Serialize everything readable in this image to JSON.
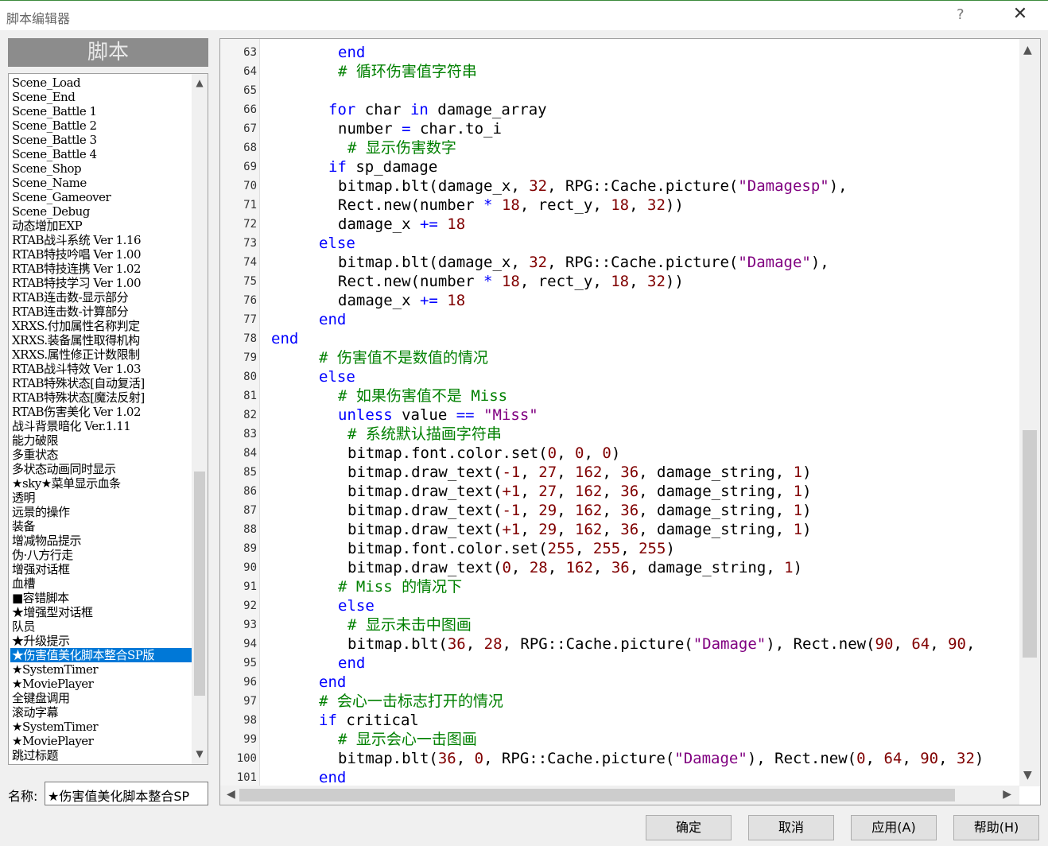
{
  "window": {
    "title": "脚本编辑器",
    "help": "?",
    "close": "✕"
  },
  "left": {
    "header": "脚本",
    "scripts": [
      "Scene_Load",
      "Scene_End",
      "Scene_Battle 1",
      "Scene_Battle 2",
      "Scene_Battle 3",
      "Scene_Battle 4",
      "Scene_Shop",
      "Scene_Name",
      "Scene_Gameover",
      "Scene_Debug",
      "动态增加EXP",
      "RTAB战斗系统 Ver 1.16",
      "RTAB特技吟唱 Ver 1.00",
      "RTAB特技连携 Ver 1.02",
      "RTAB特技学习 Ver 1.00",
      "RTAB连击数-显示部分",
      "RTAB连击数-计算部分",
      "XRXS.付加属性名称判定",
      "XRXS.装备属性取得机构",
      "XRXS.属性修正计数限制",
      "RTAB战斗特效 Ver 1.03",
      "RTAB特殊状态[自动复活]",
      "RTAB特殊状态[魔法反射]",
      "RTAB伤害美化 Ver 1.02",
      "战斗背景暗化 Ver.1.11",
      "能力破限",
      "多重状态",
      "多状态动画同时显示",
      "★sky★菜单显示血条",
      "透明",
      "远景的操作",
      "装备",
      "增减物品提示",
      "伪·八方行走",
      "增强对话框",
      "血槽",
      "■容错脚本",
      "★增强型对话框",
      "队员",
      "★升级提示",
      "★伤害值美化脚本整合SP版",
      "★SystemTimer",
      "★MoviePlayer",
      "全键盘调用",
      "滚动字幕",
      "★SystemTimer",
      "★MoviePlayer",
      "跳过标题"
    ],
    "selected_index": 40,
    "name_label": "名称:",
    "name_value": "★伤害值美化脚本整合SP"
  },
  "editor": {
    "lines": [
      {
        "n": "63",
        "indent": 4,
        "tokens": [
          [
            "kw",
            "end"
          ]
        ]
      },
      {
        "n": "64",
        "indent": 4,
        "tokens": [
          [
            "cm",
            "# 循环伤害值字符串"
          ]
        ]
      },
      {
        "n": "65",
        "indent": 0,
        "tokens": []
      },
      {
        "n": "66",
        "indent": 3,
        "tokens": [
          [
            "kw",
            "for"
          ],
          [
            "tx",
            " char "
          ],
          [
            "kw",
            "in"
          ],
          [
            "tx",
            " damage_array"
          ]
        ]
      },
      {
        "n": "67",
        "indent": 4,
        "tokens": [
          [
            "tx",
            "number "
          ],
          [
            "op",
            "="
          ],
          [
            "tx",
            " char.to_i"
          ]
        ]
      },
      {
        "n": "68",
        "indent": 5,
        "tokens": [
          [
            "cm",
            "# 显示伤害数字"
          ]
        ]
      },
      {
        "n": "69",
        "indent": 3,
        "tokens": [
          [
            "kw",
            "if"
          ],
          [
            "tx",
            " sp_damage"
          ]
        ]
      },
      {
        "n": "70",
        "indent": 4,
        "tokens": [
          [
            "tx",
            "bitmap.blt(damage_x, "
          ],
          [
            "nm",
            "32"
          ],
          [
            "tx",
            ", RPG::Cache.picture("
          ],
          [
            "st",
            "\"Damagesp\""
          ],
          [
            "tx",
            "),"
          ]
        ]
      },
      {
        "n": "71",
        "indent": 4,
        "tokens": [
          [
            "tx",
            "Rect.new(number "
          ],
          [
            "op",
            "*"
          ],
          [
            "tx",
            " "
          ],
          [
            "nm",
            "18"
          ],
          [
            "tx",
            ", rect_y, "
          ],
          [
            "nm",
            "18"
          ],
          [
            "tx",
            ", "
          ],
          [
            "nm",
            "32"
          ],
          [
            "tx",
            "))"
          ]
        ]
      },
      {
        "n": "72",
        "indent": 4,
        "tokens": [
          [
            "tx",
            "damage_x "
          ],
          [
            "op",
            "+="
          ],
          [
            "tx",
            " "
          ],
          [
            "nm",
            "18"
          ]
        ]
      },
      {
        "n": "73",
        "indent": 2,
        "tokens": [
          [
            "kw",
            "else"
          ]
        ]
      },
      {
        "n": "74",
        "indent": 4,
        "tokens": [
          [
            "tx",
            "bitmap.blt(damage_x, "
          ],
          [
            "nm",
            "32"
          ],
          [
            "tx",
            ", RPG::Cache.picture("
          ],
          [
            "st",
            "\"Damage\""
          ],
          [
            "tx",
            "),"
          ]
        ]
      },
      {
        "n": "75",
        "indent": 4,
        "tokens": [
          [
            "tx",
            "Rect.new(number "
          ],
          [
            "op",
            "*"
          ],
          [
            "tx",
            " "
          ],
          [
            "nm",
            "18"
          ],
          [
            "tx",
            ", rect_y, "
          ],
          [
            "nm",
            "18"
          ],
          [
            "tx",
            ", "
          ],
          [
            "nm",
            "32"
          ],
          [
            "tx",
            "))"
          ]
        ]
      },
      {
        "n": "76",
        "indent": 4,
        "tokens": [
          [
            "tx",
            "damage_x "
          ],
          [
            "op",
            "+="
          ],
          [
            "tx",
            " "
          ],
          [
            "nm",
            "18"
          ]
        ]
      },
      {
        "n": "77",
        "indent": 2,
        "tokens": [
          [
            "kw",
            "end"
          ]
        ]
      },
      {
        "n": "78",
        "indent": -3,
        "tokens": [
          [
            "kw",
            "end"
          ]
        ]
      },
      {
        "n": "79",
        "indent": 2,
        "tokens": [
          [
            "cm",
            "# 伤害值不是数值的情况"
          ]
        ]
      },
      {
        "n": "80",
        "indent": 2,
        "tokens": [
          [
            "kw",
            "else"
          ]
        ]
      },
      {
        "n": "81",
        "indent": 4,
        "tokens": [
          [
            "cm",
            "# 如果伤害值不是 Miss"
          ]
        ]
      },
      {
        "n": "82",
        "indent": 4,
        "tokens": [
          [
            "kw",
            "unless"
          ],
          [
            "tx",
            " value "
          ],
          [
            "op",
            "=="
          ],
          [
            "tx",
            " "
          ],
          [
            "st",
            "\"Miss\""
          ]
        ]
      },
      {
        "n": "83",
        "indent": 5,
        "tokens": [
          [
            "cm",
            "# 系统默认描画字符串"
          ]
        ]
      },
      {
        "n": "84",
        "indent": 5,
        "tokens": [
          [
            "tx",
            "bitmap.font.color.set("
          ],
          [
            "nm",
            "0"
          ],
          [
            "tx",
            ", "
          ],
          [
            "nm",
            "0"
          ],
          [
            "tx",
            ", "
          ],
          [
            "nm",
            "0"
          ],
          [
            "tx",
            ")"
          ]
        ]
      },
      {
        "n": "85",
        "indent": 5,
        "tokens": [
          [
            "tx",
            "bitmap.draw_text("
          ],
          [
            "nm",
            "-1"
          ],
          [
            "tx",
            ", "
          ],
          [
            "nm",
            "27"
          ],
          [
            "tx",
            ", "
          ],
          [
            "nm",
            "162"
          ],
          [
            "tx",
            ", "
          ],
          [
            "nm",
            "36"
          ],
          [
            "tx",
            ", damage_string, "
          ],
          [
            "nm",
            "1"
          ],
          [
            "tx",
            ")"
          ]
        ]
      },
      {
        "n": "86",
        "indent": 5,
        "tokens": [
          [
            "tx",
            "bitmap.draw_text("
          ],
          [
            "nm",
            "+1"
          ],
          [
            "tx",
            ", "
          ],
          [
            "nm",
            "27"
          ],
          [
            "tx",
            ", "
          ],
          [
            "nm",
            "162"
          ],
          [
            "tx",
            ", "
          ],
          [
            "nm",
            "36"
          ],
          [
            "tx",
            ", damage_string, "
          ],
          [
            "nm",
            "1"
          ],
          [
            "tx",
            ")"
          ]
        ]
      },
      {
        "n": "87",
        "indent": 5,
        "tokens": [
          [
            "tx",
            "bitmap.draw_text("
          ],
          [
            "nm",
            "-1"
          ],
          [
            "tx",
            ", "
          ],
          [
            "nm",
            "29"
          ],
          [
            "tx",
            ", "
          ],
          [
            "nm",
            "162"
          ],
          [
            "tx",
            ", "
          ],
          [
            "nm",
            "36"
          ],
          [
            "tx",
            ", damage_string, "
          ],
          [
            "nm",
            "1"
          ],
          [
            "tx",
            ")"
          ]
        ]
      },
      {
        "n": "88",
        "indent": 5,
        "tokens": [
          [
            "tx",
            "bitmap.draw_text("
          ],
          [
            "nm",
            "+1"
          ],
          [
            "tx",
            ", "
          ],
          [
            "nm",
            "29"
          ],
          [
            "tx",
            ", "
          ],
          [
            "nm",
            "162"
          ],
          [
            "tx",
            ", "
          ],
          [
            "nm",
            "36"
          ],
          [
            "tx",
            ", damage_string, "
          ],
          [
            "nm",
            "1"
          ],
          [
            "tx",
            ")"
          ]
        ]
      },
      {
        "n": "89",
        "indent": 5,
        "tokens": [
          [
            "tx",
            "bitmap.font.color.set("
          ],
          [
            "nm",
            "255"
          ],
          [
            "tx",
            ", "
          ],
          [
            "nm",
            "255"
          ],
          [
            "tx",
            ", "
          ],
          [
            "nm",
            "255"
          ],
          [
            "tx",
            ")"
          ]
        ]
      },
      {
        "n": "90",
        "indent": 5,
        "tokens": [
          [
            "tx",
            "bitmap.draw_text("
          ],
          [
            "nm",
            "0"
          ],
          [
            "tx",
            ", "
          ],
          [
            "nm",
            "28"
          ],
          [
            "tx",
            ", "
          ],
          [
            "nm",
            "162"
          ],
          [
            "tx",
            ", "
          ],
          [
            "nm",
            "36"
          ],
          [
            "tx",
            ", damage_string, "
          ],
          [
            "nm",
            "1"
          ],
          [
            "tx",
            ")"
          ]
        ]
      },
      {
        "n": "91",
        "indent": 4,
        "tokens": [
          [
            "cm",
            "# Miss 的情况下"
          ]
        ]
      },
      {
        "n": "92",
        "indent": 4,
        "tokens": [
          [
            "kw",
            "else"
          ]
        ]
      },
      {
        "n": "93",
        "indent": 5,
        "tokens": [
          [
            "cm",
            "# 显示未击中图画"
          ]
        ]
      },
      {
        "n": "94",
        "indent": 5,
        "tokens": [
          [
            "tx",
            "bitmap.blt("
          ],
          [
            "nm",
            "36"
          ],
          [
            "tx",
            ", "
          ],
          [
            "nm",
            "28"
          ],
          [
            "tx",
            ", RPG::Cache.picture("
          ],
          [
            "st",
            "\"Damage\""
          ],
          [
            "tx",
            "), Rect.new("
          ],
          [
            "nm",
            "90"
          ],
          [
            "tx",
            ", "
          ],
          [
            "nm",
            "64"
          ],
          [
            "tx",
            ", "
          ],
          [
            "nm",
            "90"
          ],
          [
            "tx",
            ","
          ]
        ]
      },
      {
        "n": "95",
        "indent": 4,
        "tokens": [
          [
            "kw",
            "end"
          ]
        ]
      },
      {
        "n": "96",
        "indent": 2,
        "tokens": [
          [
            "kw",
            "end"
          ]
        ]
      },
      {
        "n": "97",
        "indent": 2,
        "tokens": [
          [
            "cm",
            "# 会心一击标志打开的情况"
          ]
        ]
      },
      {
        "n": "98",
        "indent": 2,
        "tokens": [
          [
            "kw",
            "if"
          ],
          [
            "tx",
            " critical"
          ]
        ]
      },
      {
        "n": "99",
        "indent": 4,
        "tokens": [
          [
            "cm",
            "# 显示会心一击图画"
          ]
        ]
      },
      {
        "n": "100",
        "indent": 4,
        "tokens": [
          [
            "tx",
            "bitmap.blt("
          ],
          [
            "nm",
            "36"
          ],
          [
            "tx",
            ", "
          ],
          [
            "nm",
            "0"
          ],
          [
            "tx",
            ", RPG::Cache.picture("
          ],
          [
            "st",
            "\"Damage\""
          ],
          [
            "tx",
            "), Rect.new("
          ],
          [
            "nm",
            "0"
          ],
          [
            "tx",
            ", "
          ],
          [
            "nm",
            "64"
          ],
          [
            "tx",
            ", "
          ],
          [
            "nm",
            "90"
          ],
          [
            "tx",
            ", "
          ],
          [
            "nm",
            "32"
          ],
          [
            "tx",
            ")"
          ]
        ]
      },
      {
        "n": "101",
        "indent": 2,
        "tokens": [
          [
            "kw",
            "end"
          ]
        ]
      }
    ]
  },
  "buttons": {
    "ok": "确定",
    "cancel": "取消",
    "apply": "应用(A)",
    "help": "帮助(H)"
  }
}
